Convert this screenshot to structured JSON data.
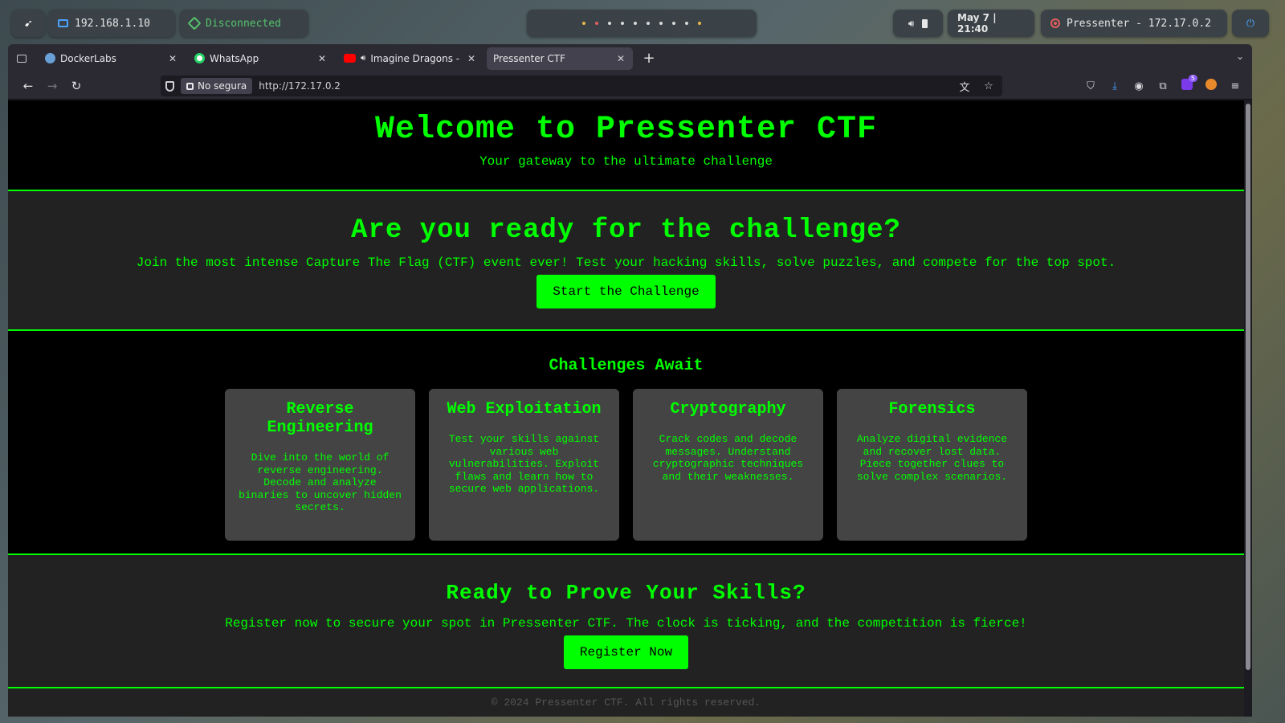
{
  "system_bar": {
    "ip": "192.168.1.10",
    "vpn_status": "Disconnected",
    "clock": "May 7 | 21:40",
    "target": "Pressenter - 172.17.0.2",
    "workspaces": [
      "active",
      "alert",
      "normal",
      "normal",
      "normal",
      "normal",
      "normal",
      "normal",
      "normal",
      "active"
    ]
  },
  "browser": {
    "tabs": [
      {
        "label": "DockerLabs",
        "icon": "docker-favicon"
      },
      {
        "label": "WhatsApp",
        "icon": "whatsapp-favicon"
      },
      {
        "label": "Imagine Dragons - Be",
        "icon": "youtube-favicon"
      },
      {
        "label": "Pressenter CTF",
        "icon": "none"
      }
    ],
    "active_tab": 3,
    "security_label": "No segura",
    "url": "http://172.17.0.2",
    "extension_badge": "5"
  },
  "page": {
    "hero": {
      "title": "Welcome to Pressenter CTF",
      "subtitle": "Your gateway to the ultimate challenge"
    },
    "intro": {
      "title": "Are you ready for the challenge?",
      "text": "Join the most intense Capture The Flag (CTF) event ever! Test your hacking skills, solve puzzles, and compete for the top spot.",
      "button": "Start the Challenge"
    },
    "challenges": {
      "title": "Challenges Await",
      "cards": [
        {
          "title": "Reverse Engineering",
          "text": "Dive into the world of reverse engineering. Decode and analyze binaries to uncover hidden secrets."
        },
        {
          "title": "Web Exploitation",
          "text": "Test your skills against various web vulnerabilities. Exploit flaws and learn how to secure web applications."
        },
        {
          "title": "Cryptography",
          "text": "Crack codes and decode messages. Understand cryptographic techniques and their weaknesses."
        },
        {
          "title": "Forensics",
          "text": "Analyze digital evidence and recover lost data. Piece together clues to solve complex scenarios."
        }
      ]
    },
    "register": {
      "title": "Ready to Prove Your Skills?",
      "text": "Register now to secure your spot in Pressenter CTF. The clock is ticking, and the competition is fierce!",
      "button": "Register Now"
    },
    "footer": "© 2024 Pressenter CTF. All rights reserved."
  },
  "colors": {
    "accent": "#00ff00",
    "page_bg_dark": "#000000",
    "page_bg_section": "#222222",
    "card_bg": "#444444"
  }
}
